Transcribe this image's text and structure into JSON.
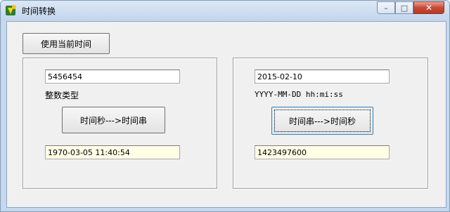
{
  "window": {
    "title": "时间转换",
    "icon": "app-icon"
  },
  "toolbar": {
    "use_current_time_label": "使用当前时间"
  },
  "left_panel": {
    "integer_input_value": "5456454",
    "type_label": "整数类型",
    "convert_button_label": "时间秒--->时间串",
    "result_value": "1970-03-05 11:40:54"
  },
  "right_panel": {
    "date_input_value": "2015-02-10",
    "format_label": "YYYY-MM-DD hh:mi:ss",
    "convert_button_label": "时间串--->时间秒",
    "result_value": "1423497600"
  },
  "colors": {
    "titlebar": "#c4d6ec",
    "client_bg": "#f0f0f0",
    "close_button": "#c74a35",
    "readonly_field": "#ffffe6"
  }
}
